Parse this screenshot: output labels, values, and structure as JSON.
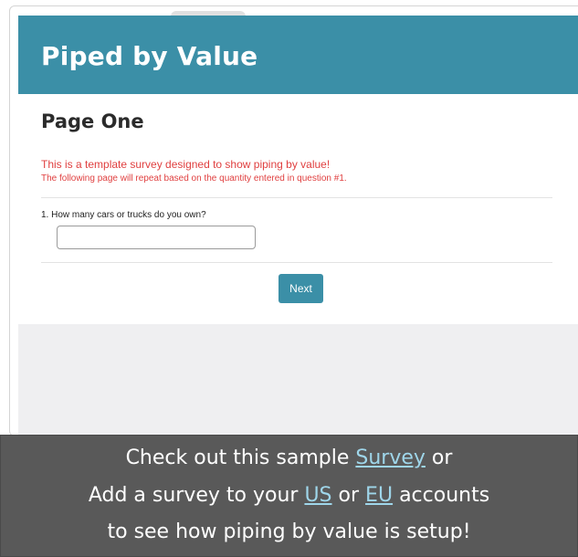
{
  "survey": {
    "title": "Piped by Value",
    "page_title": "Page One",
    "intro_line1": "This is a template survey designed to show piping by value!",
    "intro_line2": "The following page will repeat based on the quantity entered in question #1.",
    "question_label": "1. How many cars or trucks do you own?",
    "answer_value": "",
    "next_label": "Next"
  },
  "banner": {
    "line1_text": "Check out this sample",
    "line1_link": "Survey",
    "line1_end": "or",
    "line2_text": "Add a survey to your",
    "line2_link_us": "US",
    "line2_mid": "or",
    "line2_link_eu": "EU",
    "line2_end": "accounts",
    "line3_text": "to see how piping by value is setup!"
  },
  "colors": {
    "header": "#3b8fa7",
    "intro_text": "#e04040",
    "banner_bg": "#595959",
    "link": "#9fd6ea"
  }
}
